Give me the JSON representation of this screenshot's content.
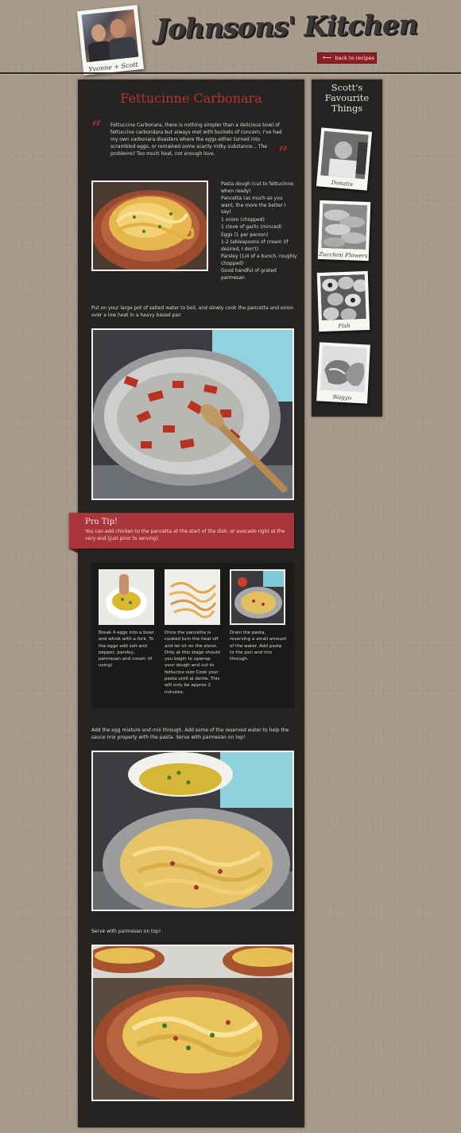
{
  "header": {
    "site_title": "Johnsons' Kitchen",
    "photo_caption": "Yvonne + Scott",
    "back_label": "back to recipes"
  },
  "recipe": {
    "title": "Fettucinne Carbonara",
    "intro": "Fettuccine Carbonara, there is nothing simpler than a delicious bowl of fettuccine carbondara but always met with buckets of concern. I've had my own carbonara disasters where the eggs either turned into scrambled eggs, or remained some scarily milky substance... The problems? Too much heat, not enough love.",
    "ingredients": [
      "Pasta dough (cut to fettucinne when ready)",
      "Pancetta (as much as you want, the more the better I say)",
      "1 onion (chopped)",
      "1 clove of garlic (minced)",
      "Eggs (1 per person)",
      "1-2 tablespoons of cream (if desired, I don't)",
      "Parsley (1/4 of a bunch, roughly chopped)",
      "Good handful of grated parmesan"
    ],
    "step1": "Put on your large pot of salted water to boil, and slowly cook the pancetta and onion over a low heat in a heavy based pan",
    "protip": {
      "title": "Pro Tip!",
      "text": "You can add chicken to the pancetta at the start of the dish, or avocado right at the very end (just prior to serving)."
    },
    "steps": [
      "Break 4 eggs into a bowl and whisk with a fork. To the eggs add salt and pepper, parsley, parmesan and cream (if using)",
      "Once the pancetta is cooked turn the heat off and let sit on the stove. Only at this stage should you begin to upwrap your dough and cut to fettucine size Cook your pasta until al dente. This will only be approx 2 minutes.",
      "Drain the pasta, reserving a small amount of the water. Add pasta to the pan and mix through."
    ],
    "step_mix": "Add the egg mixture and mix through. Add some of the reserved water to help the sauce mix properly with the pasta. Serve with parmesan on top!",
    "step_serve": "Serve with parmesan on top!"
  },
  "sidebar": {
    "title": "Scott's Favourite Things",
    "items": [
      {
        "label": "Donatis"
      },
      {
        "label": "Zucchini Flowers"
      },
      {
        "label": "Fish"
      },
      {
        "label": "Wagyu"
      }
    ]
  },
  "colors": {
    "accent_red": "#a9343a",
    "title_red": "#b83233",
    "panel": "#252423"
  }
}
